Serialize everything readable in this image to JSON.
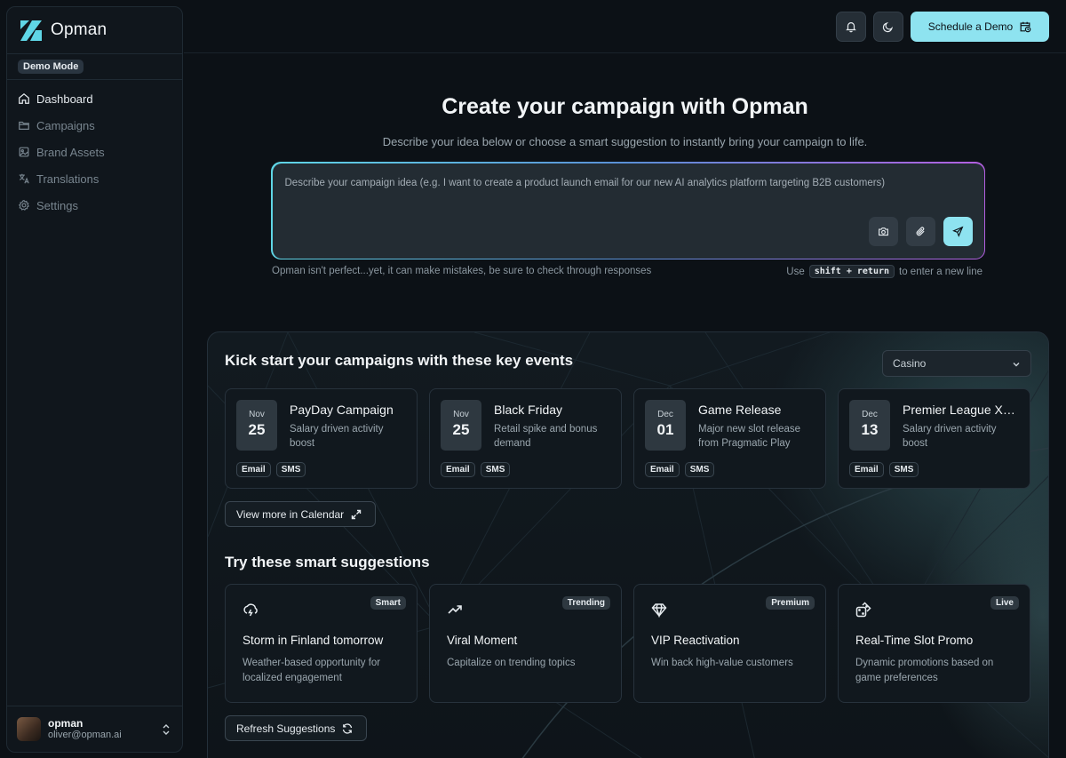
{
  "app": {
    "name": "Opman",
    "mode_badge": "Demo Mode"
  },
  "colors": {
    "accent": "#8ee3f0",
    "background": "#0c1116",
    "panel": "#11181e",
    "gradient_start": "#5fd6e6",
    "gradient_end": "#b35fe0"
  },
  "sidebar": {
    "items": [
      {
        "label": "Dashboard",
        "icon": "home-icon",
        "active": true
      },
      {
        "label": "Campaigns",
        "icon": "folder-icon",
        "active": false
      },
      {
        "label": "Brand Assets",
        "icon": "image-icon",
        "active": false
      },
      {
        "label": "Translations",
        "icon": "translate-icon",
        "active": false
      },
      {
        "label": "Settings",
        "icon": "gear-icon",
        "active": false
      }
    ],
    "user": {
      "name": "opman",
      "email": "oliver@opman.ai"
    }
  },
  "topbar": {
    "schedule_label": "Schedule a Demo"
  },
  "hero": {
    "title": "Create your campaign with Opman",
    "subtitle": "Describe your idea below or choose a smart suggestion to instantly bring your campaign to life.",
    "placeholder": "Describe your campaign idea (e.g. I want to create a product launch email for our new AI analytics platform targeting B2B customers)",
    "disclaimer": "Opman isn't perfect...yet, it can make mistakes, be sure to check through responses",
    "hint_prefix": "Use",
    "hint_key": "shift + return",
    "hint_suffix": "to enter a new line"
  },
  "events": {
    "title": "Kick start your campaigns with these key events",
    "filter": "Casino",
    "cards": [
      {
        "month": "Nov",
        "day": "25",
        "title": "PayDay Campaign",
        "desc": "Salary driven activity boost",
        "tags": [
          "Email",
          "SMS"
        ]
      },
      {
        "month": "Nov",
        "day": "25",
        "title": "Black Friday",
        "desc": "Retail spike and bonus demand",
        "tags": [
          "Email",
          "SMS"
        ]
      },
      {
        "month": "Dec",
        "day": "01",
        "title": "Game Release",
        "desc": "Major new slot release from Pragmatic Play",
        "tags": [
          "Email",
          "SMS"
        ]
      },
      {
        "month": "Dec",
        "day": "13",
        "title": "Premier League Xmas Special",
        "desc": "Salary driven activity boost",
        "tags": [
          "Email",
          "SMS"
        ]
      }
    ],
    "calendar_label": "View more in Calendar"
  },
  "suggestions": {
    "title": "Try these smart suggestions",
    "cards": [
      {
        "badge": "Smart",
        "icon": "cloud-lightning-icon",
        "title": "Storm in Finland tomorrow",
        "desc": "Weather-based opportunity for localized engagement"
      },
      {
        "badge": "Trending",
        "icon": "trending-up-icon",
        "title": "Viral Moment",
        "desc": "Capitalize on trending topics"
      },
      {
        "badge": "Premium",
        "icon": "diamond-icon",
        "title": "VIP Reactivation",
        "desc": "Win back high-value customers"
      },
      {
        "badge": "Live",
        "icon": "dice-icon",
        "title": "Real-Time Slot Promo",
        "desc": "Dynamic promotions based on game preferences"
      }
    ],
    "refresh_label": "Refresh Suggestions"
  }
}
